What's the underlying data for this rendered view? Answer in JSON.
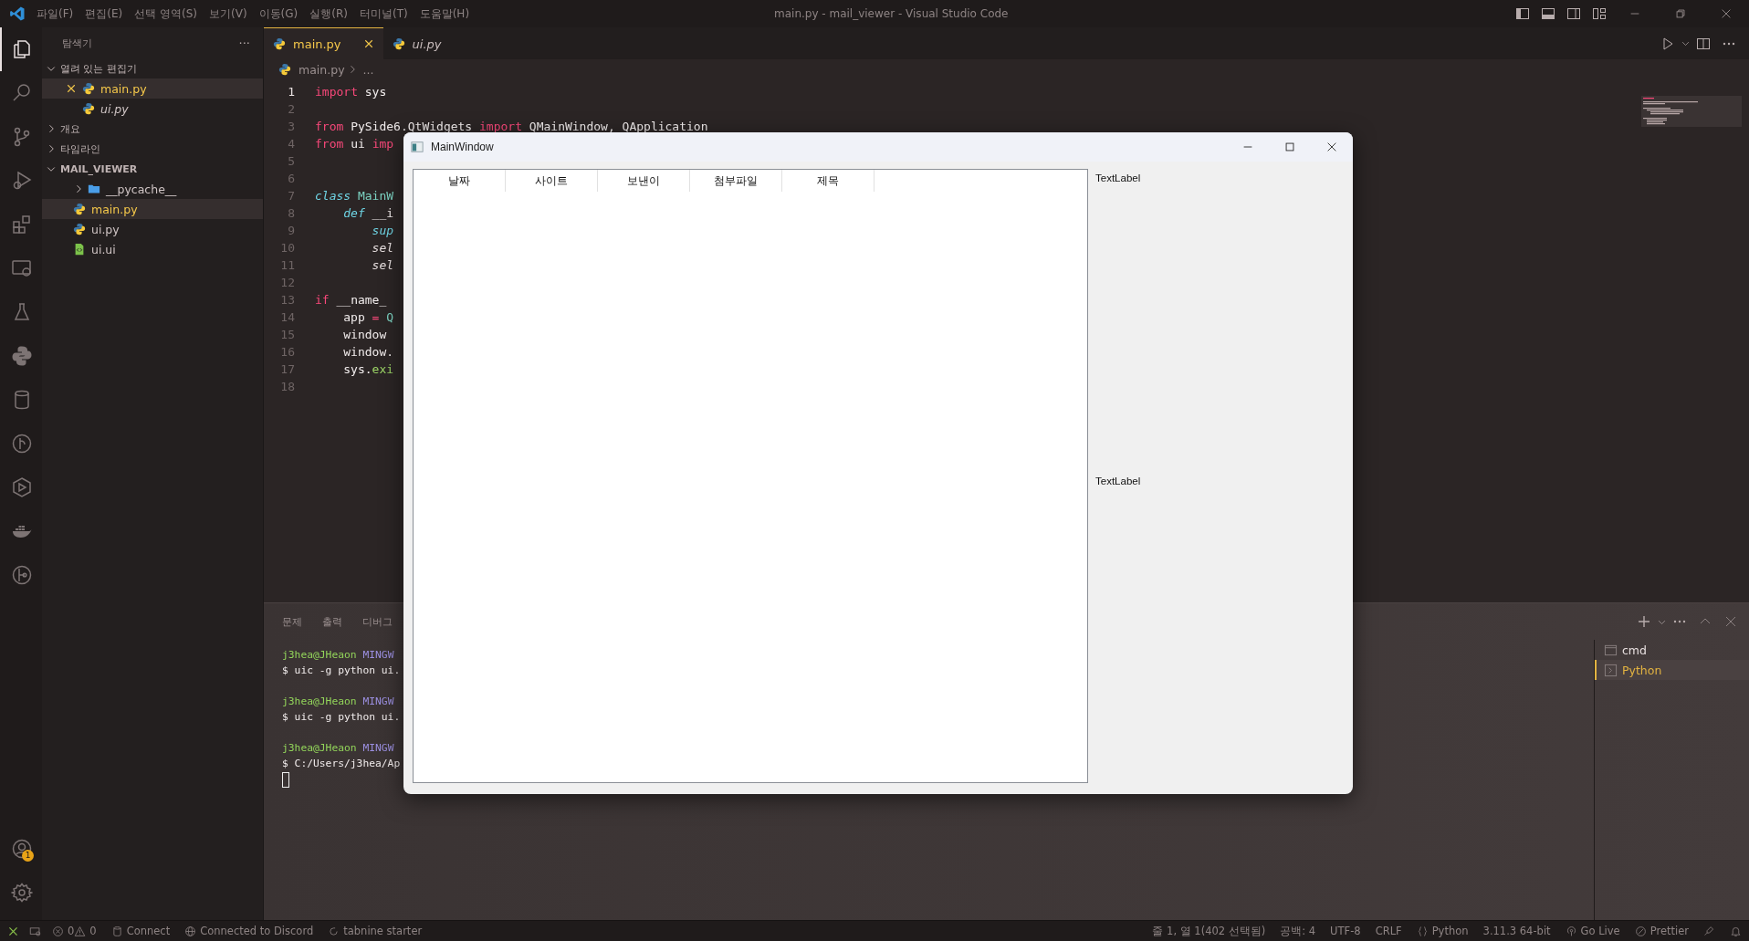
{
  "window": {
    "title": "main.py - mail_viewer - Visual Studio Code"
  },
  "menu": [
    "파일(F)",
    "편집(E)",
    "선택 영역(S)",
    "보기(V)",
    "이동(G)",
    "실행(R)",
    "터미널(T)",
    "도움말(H)"
  ],
  "activity_bar": {
    "items": [
      {
        "kind": "explorer",
        "selected": true
      },
      {
        "kind": "search",
        "selected": false
      },
      {
        "kind": "source-control",
        "selected": false
      },
      {
        "kind": "run",
        "selected": false
      },
      {
        "kind": "extensions",
        "selected": false
      },
      {
        "kind": "remote",
        "selected": false
      },
      {
        "kind": "testing",
        "selected": false
      },
      {
        "kind": "python",
        "selected": false
      },
      {
        "kind": "database",
        "selected": false
      },
      {
        "kind": "git-graph",
        "selected": false
      },
      {
        "kind": "deploy",
        "selected": false
      },
      {
        "kind": "docker",
        "selected": false
      },
      {
        "kind": "gitlens",
        "selected": false
      }
    ],
    "account_badge": "1"
  },
  "sidebar": {
    "title": "탐색기",
    "more": "···",
    "sections": [
      {
        "label": "열려 있는 편집기",
        "expanded": true,
        "items": [
          {
            "name": "main.py",
            "kind": "python",
            "selected": true,
            "modified": true,
            "preview": false,
            "closable": true
          },
          {
            "name": "ui.py",
            "kind": "python",
            "selected": false,
            "modified": false,
            "preview": true,
            "closable": false
          }
        ]
      },
      {
        "label": "개요",
        "expanded": false
      },
      {
        "label": "타임라인",
        "expanded": false
      },
      {
        "label": "MAIL_VIEWER",
        "expanded": true,
        "items": [
          {
            "name": "__pycache__",
            "kind": "folder",
            "selected": false,
            "modified": false,
            "preview": false,
            "closable": false
          },
          {
            "name": "main.py",
            "kind": "python",
            "selected": true,
            "modified": true,
            "preview": false,
            "closable": false
          },
          {
            "name": "ui.py",
            "kind": "python",
            "selected": false,
            "modified": false,
            "preview": false,
            "closable": false
          },
          {
            "name": "ui.ui",
            "kind": "ui",
            "selected": false,
            "modified": false,
            "preview": false,
            "closable": false
          }
        ]
      }
    ]
  },
  "tabs": [
    {
      "label": "main.py",
      "selected": true,
      "modified": true,
      "preview": false
    },
    {
      "label": "ui.py",
      "selected": false,
      "modified": false,
      "preview": true
    }
  ],
  "breadcrumb": {
    "file": "main.py",
    "rest": "..."
  },
  "code": [
    {
      "n": "1",
      "current": true,
      "tokens": [
        {
          "kind": "kw",
          "text": "import"
        },
        {
          "kind": "plain",
          "text": " sys"
        }
      ]
    },
    {
      "n": "2",
      "current": false
    },
    {
      "n": "3",
      "current": false,
      "tokens": [
        {
          "kind": "kw",
          "text": "from"
        },
        {
          "kind": "plain",
          "text": " PySide6.QtWidgets "
        },
        {
          "kind": "kw",
          "text": "import"
        },
        {
          "kind": "plain",
          "text": " QMainWindow, QApplication"
        }
      ]
    },
    {
      "n": "4",
      "current": false,
      "tokens": [
        {
          "kind": "kw",
          "text": "from"
        },
        {
          "kind": "plain",
          "text": " ui "
        },
        {
          "kind": "kw",
          "text": "imp"
        }
      ]
    },
    {
      "n": "5",
      "current": false
    },
    {
      "n": "6",
      "current": false
    },
    {
      "n": "7",
      "current": false,
      "tokens": [
        {
          "kind": "storage",
          "text": "class"
        },
        {
          "kind": "cls",
          "text": " MainW"
        }
      ],
      "children": [
        {
          "n": "8",
          "current": false,
          "tokens": [
            {
              "kind": "storage",
              "text": "def"
            },
            {
              "kind": "plain",
              "text": " __i"
            }
          ],
          "children": [
            {
              "n": "9",
              "current": false,
              "tokens": [
                {
                  "kind": "storage",
                  "text": "sup"
                }
              ]
            },
            {
              "n": "10",
              "current": false,
              "tokens": [
                {
                  "kind": "self",
                  "text": "sel"
                }
              ]
            },
            {
              "n": "11",
              "current": false,
              "tokens": [
                {
                  "kind": "self",
                  "text": "sel"
                }
              ]
            }
          ]
        }
      ]
    },
    {
      "n": "12",
      "current": false
    },
    {
      "n": "13",
      "current": false,
      "tokens": [
        {
          "kind": "kw",
          "text": "if"
        },
        {
          "kind": "plain",
          "text": " __name_"
        }
      ],
      "children": [
        {
          "n": "14",
          "current": false,
          "tokens": [
            {
              "kind": "plain",
              "text": "app "
            },
            {
              "kind": "kw",
              "text": "="
            },
            {
              "kind": "cls",
              "text": " Q"
            }
          ]
        },
        {
          "n": "15",
          "current": false,
          "tokens": [
            {
              "kind": "plain",
              "text": "window"
            }
          ]
        },
        {
          "n": "16",
          "current": false,
          "tokens": [
            {
              "kind": "plain",
              "text": "window."
            }
          ]
        },
        {
          "n": "17",
          "current": false,
          "tokens": [
            {
              "kind": "plain",
              "text": "sys."
            },
            {
              "kind": "fn",
              "text": "exi"
            }
          ]
        }
      ]
    },
    {
      "n": "18",
      "current": false
    }
  ],
  "panel": {
    "tabs": [
      {
        "label": "문제",
        "selected": false
      },
      {
        "label": "출력",
        "selected": false
      },
      {
        "label": "디버그",
        "selected": false
      }
    ],
    "terminal": [
      {
        "kind": "prompt",
        "user": "j3hea@JHeaon",
        "host": "MINGW"
      },
      {
        "kind": "command",
        "text": "$ uic -g python ui."
      },
      {
        "kind": "blank"
      },
      {
        "kind": "prompt",
        "user": "j3hea@JHeaon",
        "host": "MINGW"
      },
      {
        "kind": "command",
        "text": "$ uic -g python ui."
      },
      {
        "kind": "blank"
      },
      {
        "kind": "prompt",
        "user": "j3hea@JHeaon",
        "host": "MINGW"
      },
      {
        "kind": "command",
        "text": "$ C:/Users/j3hea/Ap"
      },
      {
        "kind": "cursor"
      }
    ],
    "terminals": [
      {
        "name": "cmd",
        "kind": "cmd",
        "selected": false
      },
      {
        "name": "Python",
        "kind": "python",
        "selected": true
      }
    ]
  },
  "status_bar": {
    "left": [
      {
        "kind": "remote"
      },
      {
        "kind": "problems",
        "errors": "0",
        "warnings": "0"
      },
      {
        "kind": "connect",
        "text": "Connect"
      },
      {
        "kind": "discord",
        "text": "Connected to Discord"
      },
      {
        "kind": "tabnine",
        "text": "tabnine starter"
      }
    ],
    "right": [
      {
        "kind": "position",
        "text": "줄 1, 열 1(402 선택됨)"
      },
      {
        "kind": "indent",
        "text": "공백: 4"
      },
      {
        "kind": "encoding",
        "text": "UTF-8"
      },
      {
        "kind": "eol",
        "text": "CRLF"
      },
      {
        "kind": "language",
        "text": "Python"
      },
      {
        "kind": "interpreter",
        "text": "3.11.3 64-bit"
      },
      {
        "kind": "live",
        "text": "Go Live"
      },
      {
        "kind": "prettier",
        "text": "Prettier"
      },
      {
        "kind": "feedback"
      },
      {
        "kind": "bell"
      }
    ]
  },
  "qt_window": {
    "title": "MainWindow",
    "columns": [
      "날짜",
      "사이트",
      "보낸이",
      "첨부파일",
      "제목"
    ],
    "labels": [
      "TextLabel",
      "TextLabel"
    ]
  }
}
